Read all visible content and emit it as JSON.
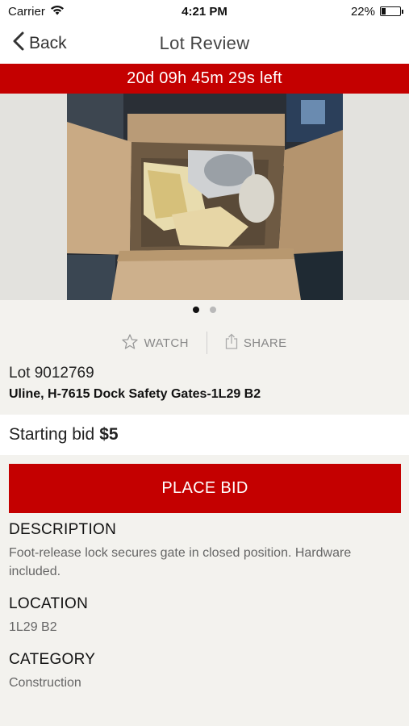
{
  "status_bar": {
    "carrier": "Carrier",
    "time": "4:21 PM",
    "battery": "22%",
    "battery_level": 0.22,
    "wifi_icon": "wifi-icon"
  },
  "nav": {
    "back_label": "Back",
    "title": "Lot Review",
    "back_icon": "chevron-left-icon"
  },
  "timer": {
    "text": "20d 09h 45m 29s left",
    "background": "#c40000"
  },
  "gallery": {
    "page_count": 2,
    "current_page": 1
  },
  "actions": {
    "watch_label": "WATCH",
    "share_label": "SHARE",
    "watch_icon": "star-outline-icon",
    "share_icon": "share-icon"
  },
  "lot": {
    "number": "Lot 9012769",
    "name": "Uline, H-7615 Dock Safety Gates-1L29 B2"
  },
  "bid": {
    "starting_label": "Starting bid",
    "starting_amount": "$5",
    "place_bid_label": "PLACE BID",
    "accent": "#c40000"
  },
  "description": {
    "heading": "DESCRIPTION",
    "text": "Foot-release lock secures gate in closed position. Hardware included."
  },
  "location": {
    "heading": "LOCATION",
    "text": "1L29 B2"
  },
  "category": {
    "heading": "CATEGORY",
    "text": "Construction"
  }
}
